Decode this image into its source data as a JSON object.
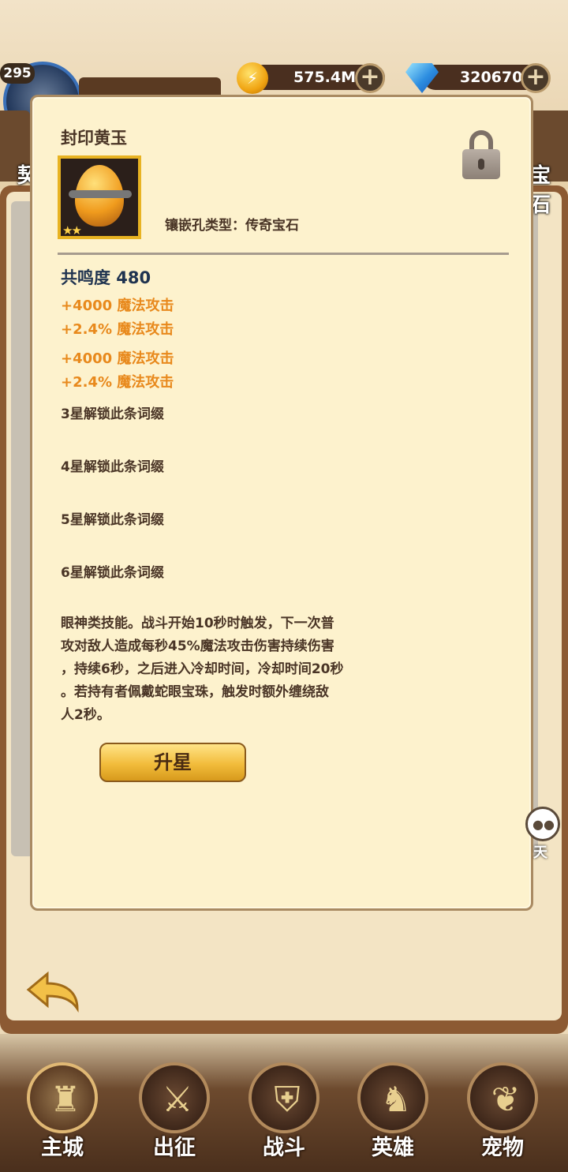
{
  "hud": {
    "level": "295",
    "player_name": "",
    "gold_value": "575.4M",
    "diamond_value": "320670",
    "left_edge_text": "契",
    "right_edge_text": "宝石",
    "chat_label": "天"
  },
  "modal": {
    "title": "封印黄玉",
    "stars": "★★",
    "socket_type": "镶嵌孔类型：传奇宝石",
    "resonance": "共鸣度 480",
    "stats": [
      "+4000 魔法攻击",
      "+2.4% 魔法攻击",
      "+4000 魔法攻击",
      "+2.4% 魔法攻击"
    ],
    "locked_affixes": [
      "3星解锁此条词缀",
      "4星解锁此条词缀",
      "5星解锁此条词缀",
      "6星解锁此条词缀"
    ],
    "description_lines": [
      "眼神类技能。战斗开始10秒时触发，下一次普",
      "攻对敌人造成每秒45%魔法攻击伤害持续伤害",
      "，持续6秒，之后进入冷却时间，冷却时间20秒",
      "。若持有者佩戴蛇眼宝珠，触发时额外缠绕敌",
      "人2秒。"
    ],
    "upgrade_label": "升星"
  },
  "nav": [
    {
      "label": "主城",
      "icon": "castle-icon",
      "glyph": "♜",
      "active": true
    },
    {
      "label": "出征",
      "icon": "crossed-swords-icon",
      "glyph": "⚔",
      "active": false
    },
    {
      "label": "战斗",
      "icon": "battle-shield-icon",
      "glyph": "⛨",
      "active": false
    },
    {
      "label": "英雄",
      "icon": "hooded-hero-icon",
      "glyph": "♞",
      "active": false
    },
    {
      "label": "宠物",
      "icon": "dragon-pet-icon",
      "glyph": "❦",
      "active": false
    }
  ],
  "colors": {
    "modal_bg": "#fdf2cd",
    "stat_orange": "#e8891c",
    "resonance_blue": "#1f3350",
    "button_gold": "#f2bc3b"
  }
}
